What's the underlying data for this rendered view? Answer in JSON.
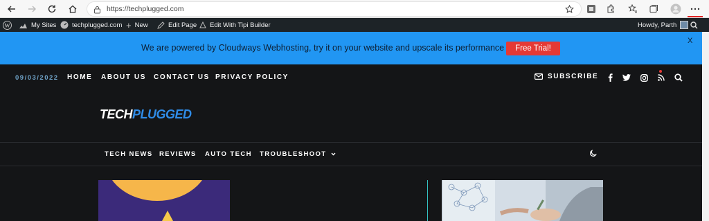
{
  "browser": {
    "url": "https://techplugged.com",
    "accent": "#e02424"
  },
  "wp_admin_bar": {
    "my_sites": "My Sites",
    "site_name": "techplugged.com",
    "new": "New",
    "edit_page": "Edit Page",
    "edit_tipi": "Edit With Tipi Builder",
    "howdy": "Howdy, Parth"
  },
  "promo": {
    "text": "We are powered by Cloudways Webhosting, try it on your website and upscale its performance",
    "button": "Free Trial!",
    "close": "X",
    "bg_color": "#2196f3",
    "button_color": "#e53935"
  },
  "site": {
    "date": "09/03/2022",
    "top_nav": [
      "HOME",
      "ABOUT US",
      "CONTACT US",
      "PRIVACY POLICY"
    ],
    "subscribe": "SUBSCRIBE",
    "social_icons": [
      "facebook-icon",
      "twitter-icon",
      "instagram-icon",
      "rss-icon",
      "search-icon"
    ],
    "logo_part1": "TECH",
    "logo_part2": "PLUGGED",
    "sub_nav": [
      "TECH NEWS",
      "REVIEWS",
      "AUTO TECH",
      "TROUBLESHOOT"
    ],
    "bg_color": "#141517",
    "logo_accent": "#2f8ce8"
  }
}
